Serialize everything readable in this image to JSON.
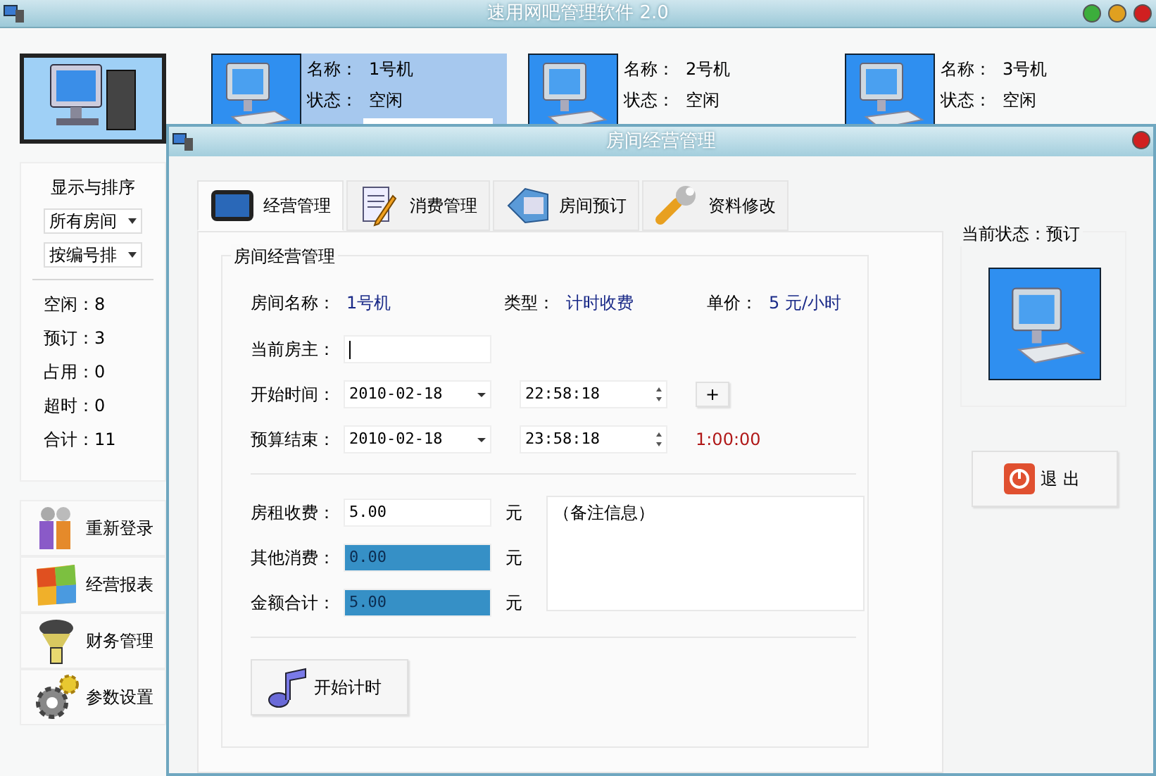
{
  "window": {
    "title": "速用网吧管理软件 2.0"
  },
  "sidebar": {
    "sort_title": "显示与排序",
    "filters": [
      {
        "value": "所有房间"
      },
      {
        "value": "按编号排"
      }
    ],
    "stats": [
      "空闲：8",
      "预订：3",
      "占用：0",
      "超时：0",
      "合计：11"
    ],
    "nav": [
      {
        "label": "重新登录",
        "kind": "users"
      },
      {
        "label": "经营报表",
        "kind": "report"
      },
      {
        "label": "财务管理",
        "kind": "tower"
      },
      {
        "label": "参数设置",
        "kind": "gears"
      }
    ]
  },
  "rooms": [
    {
      "name_label": "名称：",
      "name": "1号机",
      "status_label": "状态：",
      "status": "空闲",
      "selected": true
    },
    {
      "name_label": "名称：",
      "name": "2号机",
      "status_label": "状态：",
      "status": "空闲",
      "selected": false
    },
    {
      "name_label": "名称：",
      "name": "3号机",
      "status_label": "状态：",
      "status": "空闲",
      "selected": false
    }
  ],
  "dialog": {
    "title": "房间经营管理",
    "tabs": [
      {
        "label": "经营管理",
        "kind": "screen",
        "selected": true
      },
      {
        "label": "消费管理",
        "kind": "note",
        "selected": false
      },
      {
        "label": "房间预订",
        "kind": "card",
        "selected": false
      },
      {
        "label": "资料修改",
        "kind": "wrench",
        "selected": false
      }
    ],
    "group_title": "房间经营管理",
    "info": [
      {
        "label": "房间名称：",
        "value": "1号机"
      },
      {
        "label": "类型：",
        "value": "计时收费"
      },
      {
        "label": "单价：",
        "value": "5 元/小时"
      }
    ],
    "owner": {
      "label": "当前房主："
    },
    "start": {
      "label": "开始时间：",
      "date": "2010-02-18",
      "time": "22:58:18"
    },
    "plus_button": "+",
    "end": {
      "label": "预算结束：",
      "date": "2010-02-18",
      "time": "23:58:18",
      "duration": "1:00:00"
    },
    "fees": [
      {
        "label": "房租收费：",
        "value": "5.00",
        "unit": "元",
        "highlighted": false
      },
      {
        "label": "其他消费：",
        "value": "0.00",
        "unit": "元",
        "highlighted": true
      },
      {
        "label": "金额合计：",
        "value": "5.00",
        "unit": "元",
        "highlighted": true
      }
    ],
    "notes": "（备注信息）",
    "start_button": "开始计时",
    "status_label": "当前状态：预订",
    "exit_button": "退 出"
  }
}
